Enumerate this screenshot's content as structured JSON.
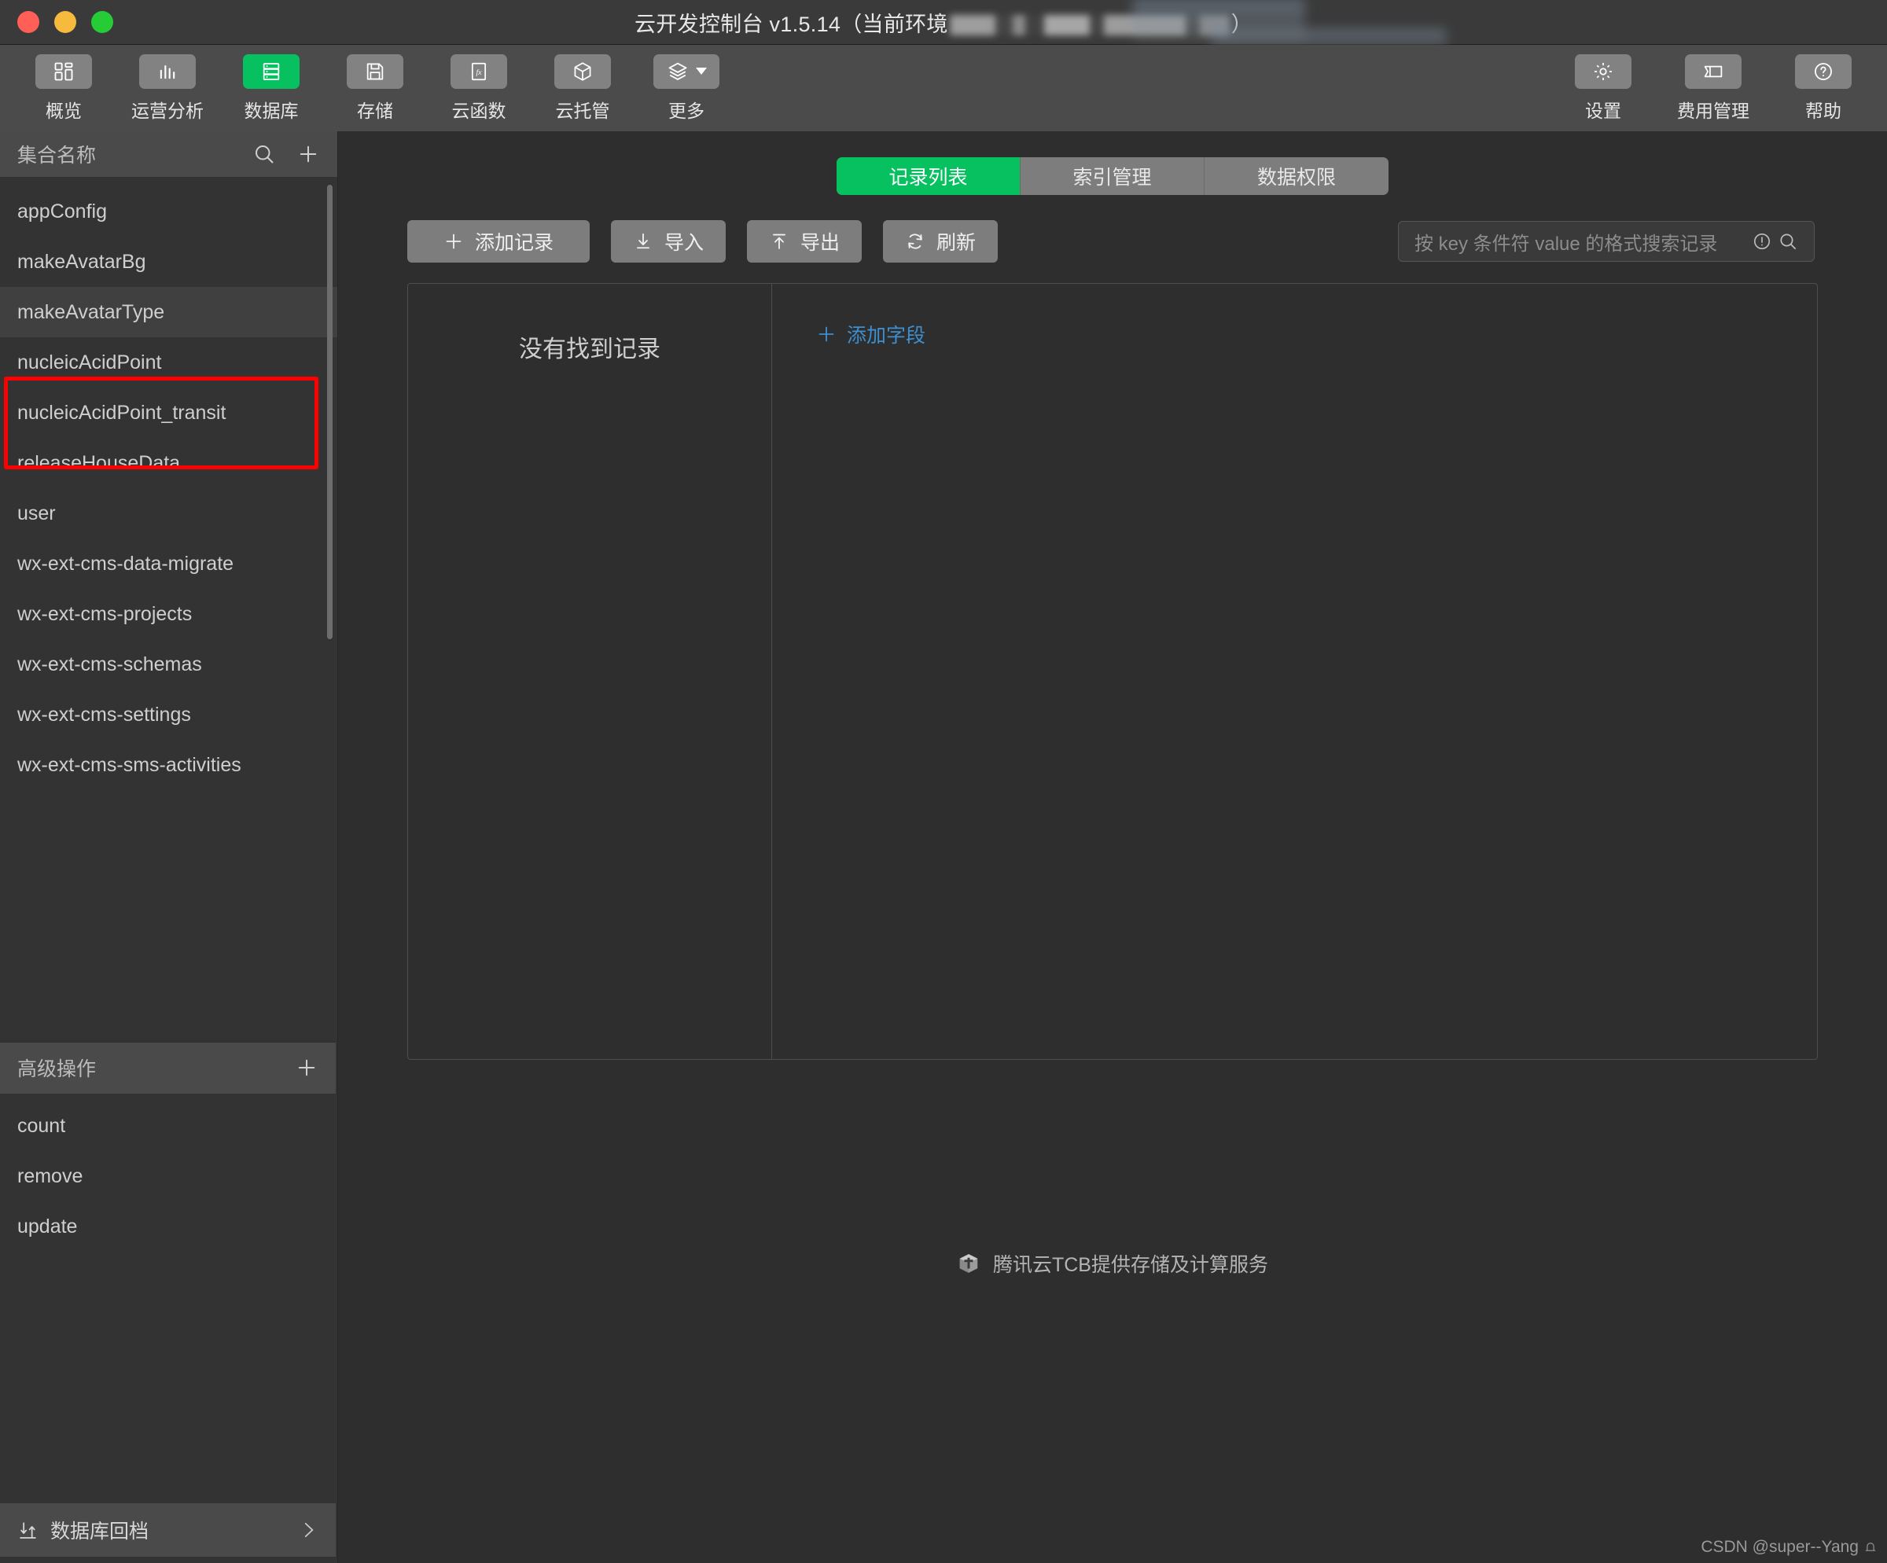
{
  "window": {
    "title_main": "云开发控制台 v1.5.14（当前环境",
    "title_tail": "）",
    "traffic_lights": [
      "close-red",
      "minimize-yellow",
      "maximize-green"
    ]
  },
  "toolbar": {
    "left_items": [
      {
        "label": "概览",
        "icon": "grid-overview-icon",
        "active": false
      },
      {
        "label": "运营分析",
        "icon": "bar-chart-icon",
        "active": false
      },
      {
        "label": "数据库",
        "icon": "database-icon",
        "active": true
      },
      {
        "label": "存储",
        "icon": "floppy-save-icon",
        "active": false
      },
      {
        "label": "云函数",
        "icon": "fx-function-icon",
        "active": false
      },
      {
        "label": "云托管",
        "icon": "cube-hosting-icon",
        "active": false
      },
      {
        "label": "更多",
        "icon": "layers-more-icon",
        "active": false,
        "has_caret": true
      }
    ],
    "right_items": [
      {
        "label": "设置",
        "icon": "gear-icon"
      },
      {
        "label": "费用管理",
        "icon": "ticket-billing-icon"
      },
      {
        "label": "帮助",
        "icon": "question-circle-icon"
      }
    ]
  },
  "sidebar": {
    "header": {
      "title": "集合名称",
      "search_icon": "search-icon",
      "add_icon": "plus-icon"
    },
    "collections": [
      {
        "name": "appConfig",
        "selected": false
      },
      {
        "name": "makeAvatarBg",
        "selected": false
      },
      {
        "name": "makeAvatarType",
        "selected": true
      },
      {
        "name": "nucleicAcidPoint",
        "selected": false
      },
      {
        "name": "nucleicAcidPoint_transit",
        "selected": false
      },
      {
        "name": "releaseHouseData",
        "selected": false
      },
      {
        "name": "user",
        "selected": false
      },
      {
        "name": "wx-ext-cms-data-migrate",
        "selected": false
      },
      {
        "name": "wx-ext-cms-projects",
        "selected": false
      },
      {
        "name": "wx-ext-cms-schemas",
        "selected": false
      },
      {
        "name": "wx-ext-cms-settings",
        "selected": false
      },
      {
        "name": "wx-ext-cms-sms-activities",
        "selected": false
      }
    ],
    "advanced": {
      "title": "高级操作",
      "add_icon": "plus-icon",
      "items": [
        {
          "name": "count"
        },
        {
          "name": "remove"
        },
        {
          "name": "update"
        }
      ]
    },
    "footer": {
      "label": "数据库回档",
      "icon": "updown-arrows-icon",
      "caret": "chevron-right-icon"
    }
  },
  "main": {
    "tabs": [
      {
        "label": "记录列表",
        "active": true
      },
      {
        "label": "索引管理",
        "active": false
      },
      {
        "label": "数据权限",
        "active": false
      }
    ],
    "actions": [
      {
        "label": "添加记录",
        "icon": "plus-icon"
      },
      {
        "label": "导入",
        "icon": "download-arrow-icon"
      },
      {
        "label": "导出",
        "icon": "upload-arrow-icon"
      },
      {
        "label": "刷新",
        "icon": "refresh-icon"
      }
    ],
    "search": {
      "placeholder": "按 key 条件符 value 的格式搜索记录",
      "value": "",
      "info_icon": "exclamation-circle-icon",
      "search_icon": "search-icon"
    },
    "empty_state": "没有找到记录",
    "add_field": {
      "label": "添加字段",
      "icon": "plus-icon"
    }
  },
  "footer": {
    "brand_text": "腾讯云TCB提供存储及计算服务",
    "brand_icon": "tencent-cloud-cube-icon"
  },
  "watermark": {
    "text": "CSDN @super--Yang"
  },
  "colors": {
    "accent_green": "#07c160",
    "annotation_red": "#fe0000",
    "link_blue": "#3d8fd0",
    "toolbar_bg": "#4b4b4b",
    "sidebar_bg": "#333333",
    "main_bg": "#2e2e2e",
    "titlebar_bg": "#3a3a3a"
  }
}
